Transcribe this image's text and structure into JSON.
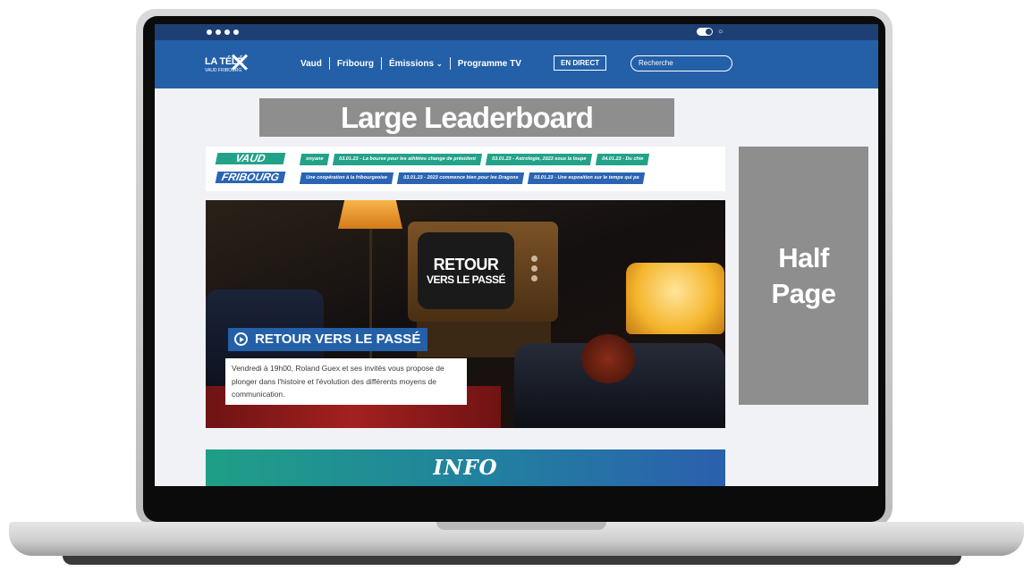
{
  "topbar": {
    "social_icons": [
      "facebook-icon",
      "instagram-icon",
      "twitter-icon",
      "youtube-icon"
    ],
    "theme_toggle_icon": "sun-icon"
  },
  "nav": {
    "logo_text": "LA TÉLÉ",
    "logo_sub": "VAUD FRIBOURG",
    "links": [
      "Vaud",
      "Fribourg",
      "Émissions",
      "Programme TV"
    ],
    "direct_label": "EN DIRECT",
    "search_placeholder": "Recherche"
  },
  "ads": {
    "leaderboard": "Large Leaderboard",
    "half_page_line1": "Half",
    "half_page_line2": "Page"
  },
  "ticker": {
    "vaud": {
      "label": "VAUD",
      "items": [
        "onyane",
        "03.01.23 - La bourse pour les athlètes change de président",
        "03.01.23 - Astrologie, 2023 sous la loupe",
        "04.01.23 - Du chie"
      ]
    },
    "fribourg": {
      "label": "FRIBOURG",
      "items": [
        "Une coopération à la fribourgeoise",
        "03.01.23 - 2023 commence bien pour les Dragons",
        "03.01.23 - Une exposition sur le temps qui pa"
      ]
    }
  },
  "hero": {
    "tv_line1": "RETOUR",
    "tv_line2": "VERS LE PASSÉ",
    "title": "RETOUR VERS LE PASSÉ",
    "description": "Vendredi à 19h00, Roland Guex et ses invités vous propose de plonger dans l'histoire et l'évolution des différents moyens de communication."
  },
  "info_banner": "INFO",
  "colors": {
    "navy": "#1d3f73",
    "nav_blue": "#2360a8",
    "vaud_green": "#23a28a",
    "fribourg_blue": "#2a64b3",
    "ad_gray": "#8e8e8e"
  }
}
